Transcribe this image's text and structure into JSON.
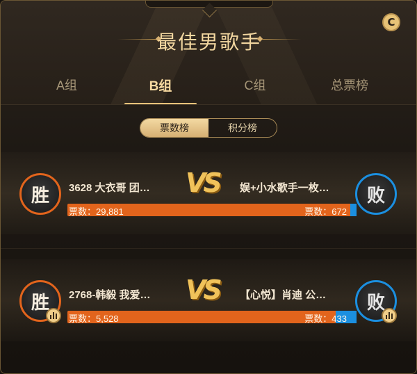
{
  "title": "最佳男歌手",
  "icons": {
    "refresh": "refresh-c-icon"
  },
  "tabs": [
    {
      "label": "A组",
      "active": false
    },
    {
      "label": "B组",
      "active": true
    },
    {
      "label": "C组",
      "active": false
    },
    {
      "label": "总票榜",
      "active": false
    }
  ],
  "segments": [
    {
      "label": "票数榜",
      "active": true
    },
    {
      "label": "积分榜",
      "active": false
    }
  ],
  "matches": [
    {
      "left": {
        "result": "胜",
        "name": "3628 大衣哥 团…",
        "votes_text": "票数：29,881",
        "votes": 29881
      },
      "vs": "VS",
      "right": {
        "result": "败",
        "name": "娱+小水歌手一枚…",
        "votes_text": "票数：672",
        "votes": 672
      },
      "left_share": 0.978,
      "show_stats": false
    },
    {
      "left": {
        "result": "胜",
        "name": "2768-韩毅 我爱…",
        "votes_text": "票数：5,528",
        "votes": 5528
      },
      "vs": "VS",
      "right": {
        "result": "败",
        "name": "【心悦】肖迪 公…",
        "votes_text": "票数：433",
        "votes": 433
      },
      "left_share": 0.927,
      "show_stats": true
    }
  ],
  "colors": {
    "accent_gold": "#e7c27a",
    "win_orange": "#e2641c",
    "lose_blue": "#1b8fe0"
  }
}
